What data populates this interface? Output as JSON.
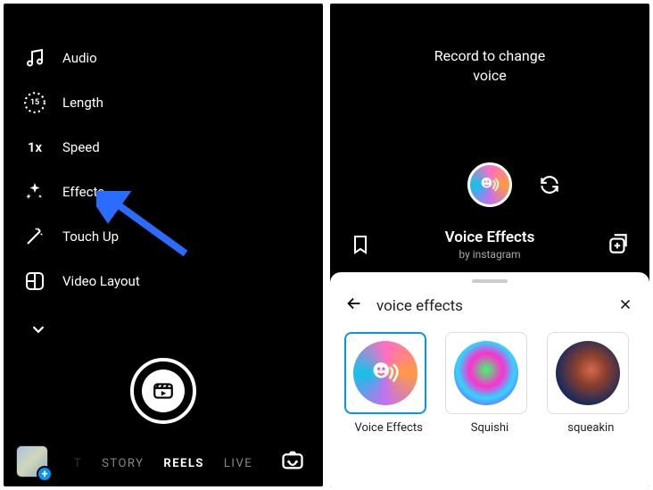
{
  "left": {
    "tools": [
      {
        "label": "Audio"
      },
      {
        "label": "Length",
        "badge": "15"
      },
      {
        "label": "Speed",
        "prefix": "1x"
      },
      {
        "label": "Effects"
      },
      {
        "label": "Touch Up"
      },
      {
        "label": "Video Layout"
      }
    ],
    "modes": [
      "T",
      "STORY",
      "REELS",
      "LIVE"
    ],
    "active_mode": "REELS"
  },
  "right": {
    "prompt_line1": "Record to change",
    "prompt_line2": "voice",
    "effect_title": "Voice Effects",
    "effect_author_prefix": "by",
    "effect_author": "instagram",
    "search_query": "voice effects",
    "results": [
      {
        "label": "Voice Effects",
        "selected": true
      },
      {
        "label": "Squishi"
      },
      {
        "label": "squeakin"
      }
    ]
  }
}
